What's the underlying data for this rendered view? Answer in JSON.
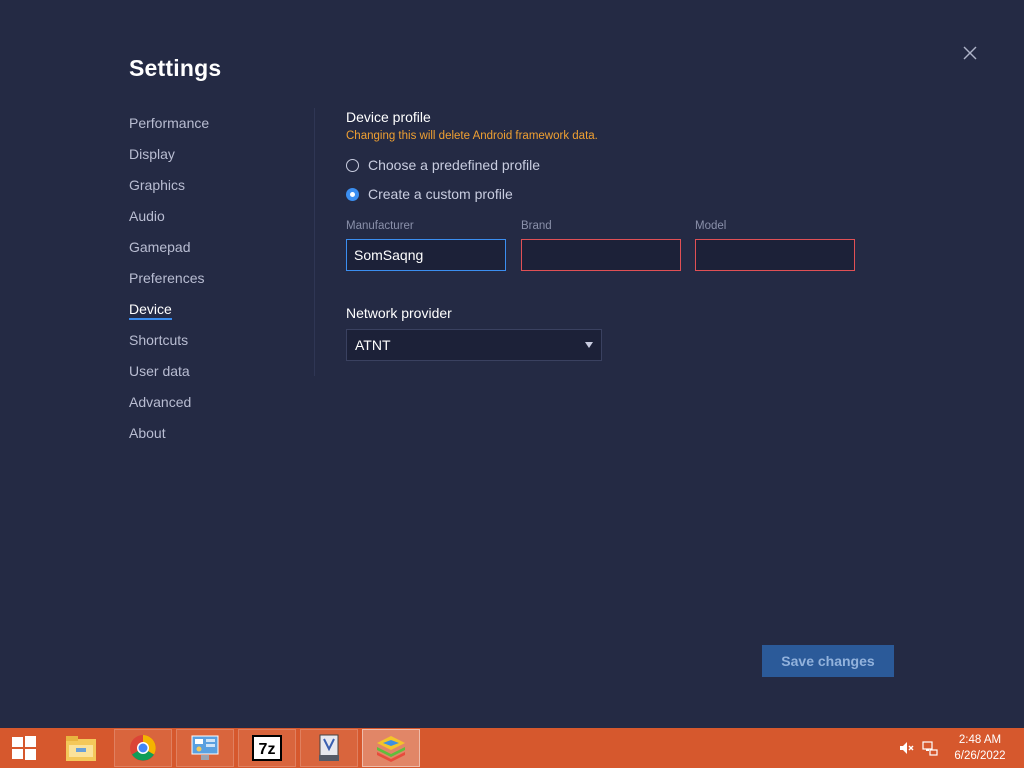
{
  "settings": {
    "title": "Settings",
    "nav": [
      {
        "label": "Performance"
      },
      {
        "label": "Display"
      },
      {
        "label": "Graphics"
      },
      {
        "label": "Audio"
      },
      {
        "label": "Gamepad"
      },
      {
        "label": "Preferences"
      },
      {
        "label": "Device"
      },
      {
        "label": "Shortcuts"
      },
      {
        "label": "User data"
      },
      {
        "label": "Advanced"
      },
      {
        "label": "About"
      }
    ],
    "active_nav": "Device"
  },
  "device": {
    "section_title": "Device profile",
    "warning": "Changing this will delete Android framework data.",
    "radio_predefined": "Choose a predefined profile",
    "radio_custom": "Create a custom profile",
    "selected_radio": "custom",
    "manufacturer": {
      "label": "Manufacturer",
      "value": "SomSaqng"
    },
    "brand": {
      "label": "Brand",
      "value": ""
    },
    "model": {
      "label": "Model",
      "value": ""
    },
    "network_label": "Network provider",
    "network_value": "ATNT"
  },
  "footer": {
    "save_label": "Save changes"
  },
  "taskbar": {
    "time": "2:48 AM",
    "date": "6/26/2022",
    "apps": [
      "file-explorer",
      "chrome",
      "control-panel",
      "7zip",
      "app-installer",
      "bluestacks"
    ]
  },
  "colors": {
    "background": "#242a44",
    "accent": "#3b8ef0",
    "warning": "#f0a032",
    "error_border": "#e05055",
    "taskbar": "#d6582d"
  }
}
